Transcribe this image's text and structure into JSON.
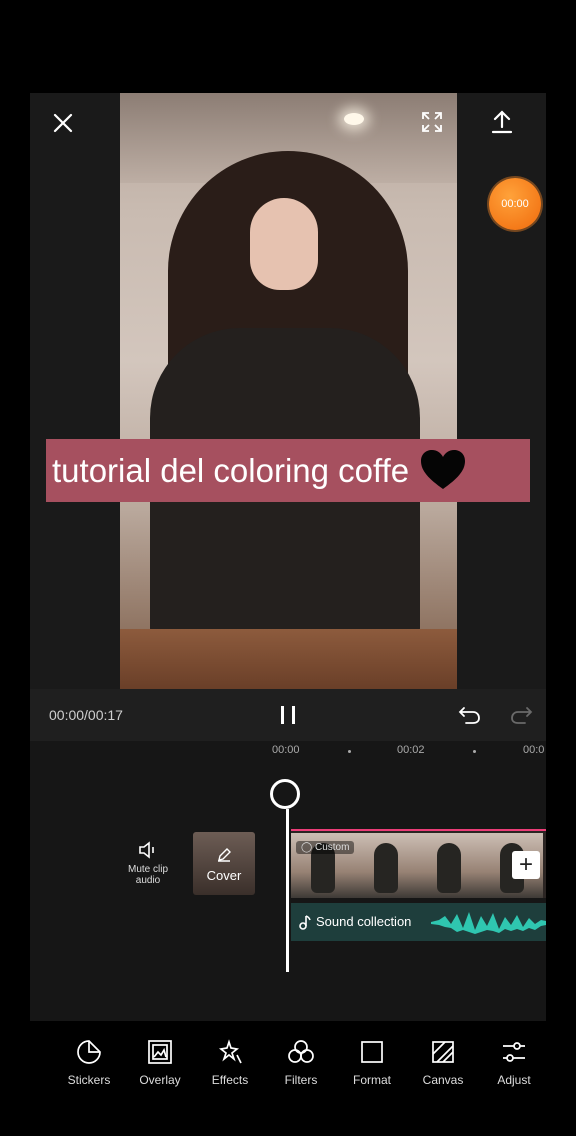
{
  "preview": {
    "timer_badge": "00:00"
  },
  "caption": {
    "text": "tutorial del coloring coffe"
  },
  "playback": {
    "time": "00:00/00:17"
  },
  "ruler": {
    "ticks": [
      "00:00",
      "00:02",
      "00:0"
    ]
  },
  "timeline": {
    "mute_label": "Mute clip audio",
    "cover_label": "Cover",
    "custom_tag": "Custom",
    "sound_label": "Sound collection"
  },
  "toolbar": {
    "items": [
      {
        "label": "Stickers",
        "icon": "sticker-icon"
      },
      {
        "label": "Overlay",
        "icon": "overlay-icon"
      },
      {
        "label": "Effects",
        "icon": "effects-icon"
      },
      {
        "label": "Filters",
        "icon": "filters-icon"
      },
      {
        "label": "Format",
        "icon": "format-icon"
      },
      {
        "label": "Canvas",
        "icon": "canvas-icon"
      },
      {
        "label": "Adjust",
        "icon": "adjust-icon"
      }
    ]
  },
  "colors": {
    "caption_bg": "#a6505f",
    "accent_pink": "#ec3d78",
    "timer_orange": "#f06a0c",
    "sound_teal": "#1e3e3c"
  }
}
